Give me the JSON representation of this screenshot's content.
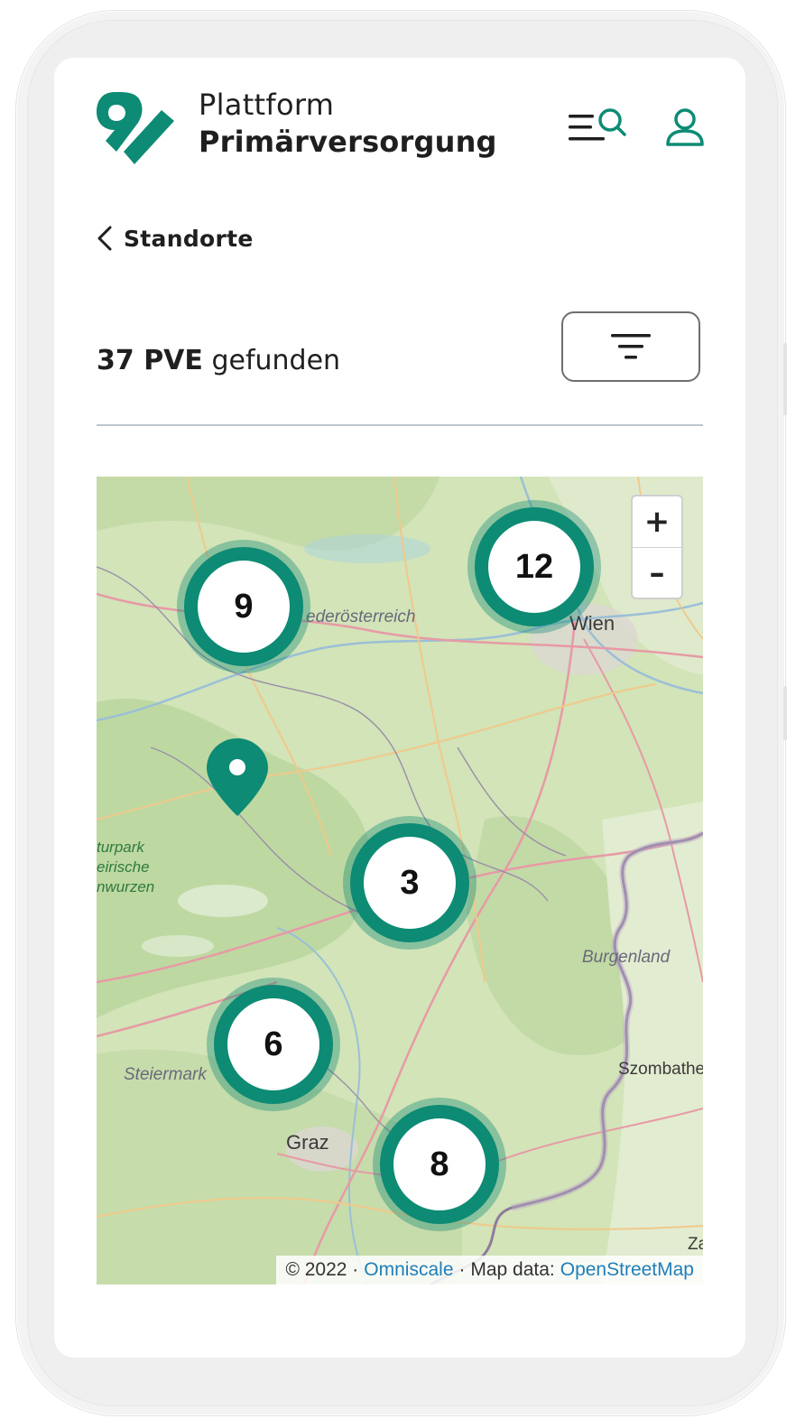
{
  "header": {
    "brand_line1": "Plattform",
    "brand_line2": "Primärversorgung",
    "menu_search_icon": "menu-search-icon",
    "user_icon": "user-icon",
    "accent_color": "#0d8b74"
  },
  "nav": {
    "back_label": "Standorte"
  },
  "results": {
    "count": "37 PVE",
    "suffix": "gefunden",
    "filter_icon": "filter-icon"
  },
  "map": {
    "zoom_in": "+",
    "zoom_out": "–",
    "clusters": [
      {
        "id": "cluster-9",
        "count": "9"
      },
      {
        "id": "cluster-12",
        "count": "12"
      },
      {
        "id": "cluster-3",
        "count": "3"
      },
      {
        "id": "cluster-6",
        "count": "6"
      },
      {
        "id": "cluster-8",
        "count": "8"
      }
    ],
    "labels": {
      "wien": "Wien",
      "graz": "Graz",
      "niederoesterreich": "ederösterreich",
      "burgenland": "Burgenland",
      "steiermark": "Steiermark",
      "szombathely": "Szombathe",
      "za": "Za",
      "park_line1": "turpark",
      "park_line2": "eirische",
      "park_line3": "nwurzen"
    },
    "attribution": {
      "copyright": "© 2022 ·",
      "omniscale": "Omniscale",
      "mapdata": "· Map data:",
      "osm": "OpenStreetMap"
    }
  }
}
